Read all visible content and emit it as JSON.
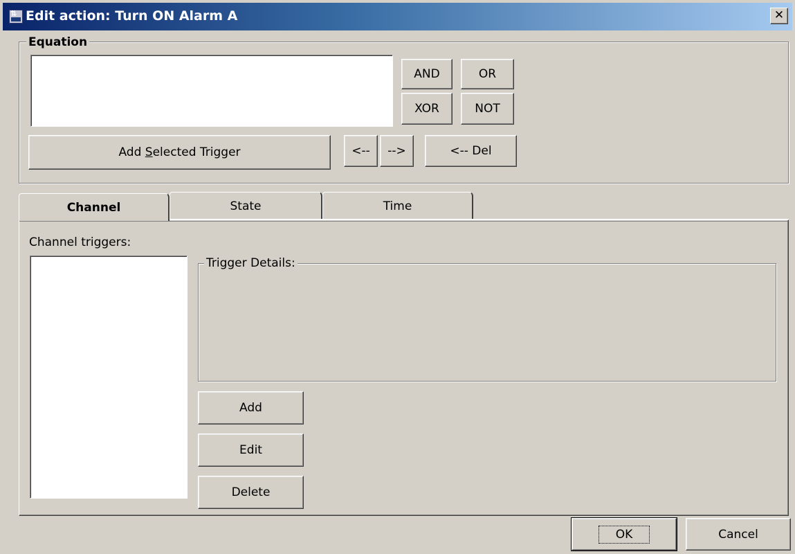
{
  "window": {
    "title": "Edit action: Turn ON Alarm A",
    "close_glyph": "✕"
  },
  "equation": {
    "legend": "Equation",
    "text_value": "",
    "operators": {
      "and": "AND",
      "or": "OR",
      "xor": "XOR",
      "not": "NOT"
    },
    "add_trigger_pre": "Add ",
    "add_trigger_mnemonic": "S",
    "add_trigger_post": "elected Trigger",
    "move_left": "<--",
    "move_right": "-->",
    "delete_left": "<-- Del"
  },
  "tabs": [
    {
      "label": "Channel",
      "active": true
    },
    {
      "label": "State",
      "active": false
    },
    {
      "label": "Time",
      "active": false
    }
  ],
  "channel_tab": {
    "triggers_label": "Channel triggers:",
    "triggers_list": [],
    "details_legend": "Trigger Details:",
    "add_label": "Add",
    "edit_label": "Edit",
    "delete_label": "Delete"
  },
  "footer": {
    "ok_label": "OK",
    "cancel_label": "Cancel"
  },
  "colors": {
    "face": "#d4d0c8",
    "titlebar_start": "#0a246a",
    "titlebar_end": "#a6caf0"
  }
}
